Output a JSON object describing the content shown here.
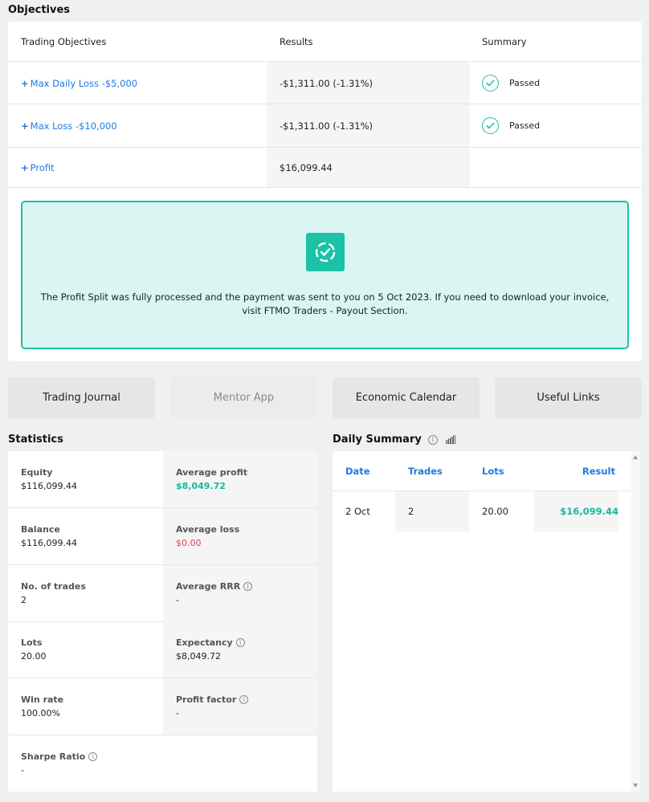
{
  "objectives": {
    "title": "Objectives",
    "headers": {
      "objectives": "Trading Objectives",
      "results": "Results",
      "summary": "Summary"
    },
    "rows": [
      {
        "name": "Max Daily Loss -$5,000",
        "result": "-$1,311.00 (-1.31%)",
        "summary": "Passed"
      },
      {
        "name": "Max Loss -$10,000",
        "result": "-$1,311.00 (-1.31%)",
        "summary": "Passed"
      },
      {
        "name": "Profit",
        "result": "$16,099.44",
        "summary": ""
      }
    ],
    "notice": "The Profit Split was fully processed and the payment was sent to you on 5 Oct 2023. If you need to download your invoice, visit FTMO Traders - Payout Section."
  },
  "buttons": {
    "trading_journal": "Trading Journal",
    "mentor_app": "Mentor App",
    "economic_calendar": "Economic Calendar",
    "useful_links": "Useful Links"
  },
  "statistics": {
    "title": "Statistics",
    "equity": {
      "label": "Equity",
      "value": "$116,099.44"
    },
    "average_profit": {
      "label": "Average profit",
      "value": "$8,049.72"
    },
    "balance": {
      "label": "Balance",
      "value": "$116,099.44"
    },
    "average_loss": {
      "label": "Average loss",
      "value": "$0.00"
    },
    "trades": {
      "label": "No. of trades",
      "value": "2"
    },
    "average_rrr": {
      "label": "Average RRR",
      "value": "-"
    },
    "lots": {
      "label": "Lots",
      "value": "20.00"
    },
    "expectancy": {
      "label": "Expectancy",
      "value": "$8,049.72"
    },
    "win_rate": {
      "label": "Win rate",
      "value": "100.00%"
    },
    "profit_factor": {
      "label": "Profit factor",
      "value": "-"
    },
    "sharpe_ratio": {
      "label": "Sharpe Ratio",
      "value": "-"
    }
  },
  "daily_summary": {
    "title": "Daily Summary",
    "headers": {
      "date": "Date",
      "trades": "Trades",
      "lots": "Lots",
      "result": "Result"
    },
    "rows": [
      {
        "date": "2 Oct",
        "trades": "2",
        "lots": "20.00",
        "result": "$16,099.44"
      }
    ]
  },
  "colors": {
    "accent_green": "#1cc2a5",
    "link_blue": "#1f7ae0",
    "loss_red": "#e0404f"
  }
}
